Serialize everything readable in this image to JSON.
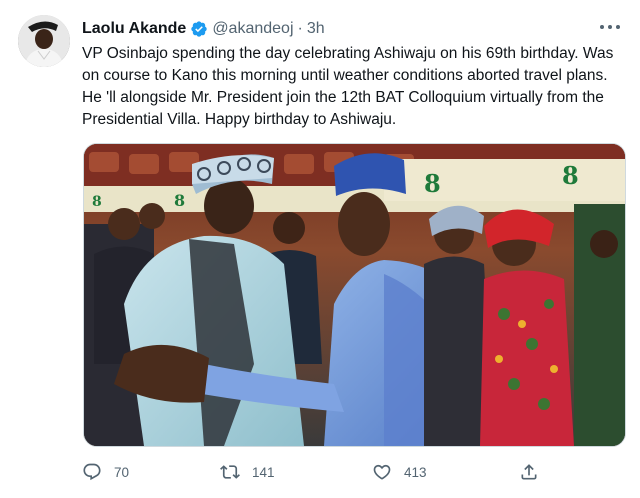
{
  "tweet": {
    "author_name": "Laolu Akande",
    "handle": "@akandeoj",
    "separator": "·",
    "time": "3h",
    "text": "VP Osinbajo spending the day celebrating Ashiwaju on his 69th birthday. Was on course to Kano this morning until weather conditions aborted travel plans. He 'll alongside Mr. President join the 12th BAT Colloquium virtually from the Presidential Villa. Happy birthday to Ashiwaju.",
    "media_icon": "photo",
    "backdrop_banner_text": "8"
  },
  "actions": {
    "reply_count": "70",
    "retweet_count": "141",
    "like_count": "413"
  },
  "icons": {
    "verified": "verified-badge-icon",
    "more": "more-dots-icon",
    "reply": "reply-icon",
    "retweet": "retweet-icon",
    "like": "heart-icon",
    "share": "share-icon"
  },
  "colors": {
    "verified": "#1d9bf0",
    "secondary_text": "#536471",
    "primary_text": "#0f1419"
  }
}
